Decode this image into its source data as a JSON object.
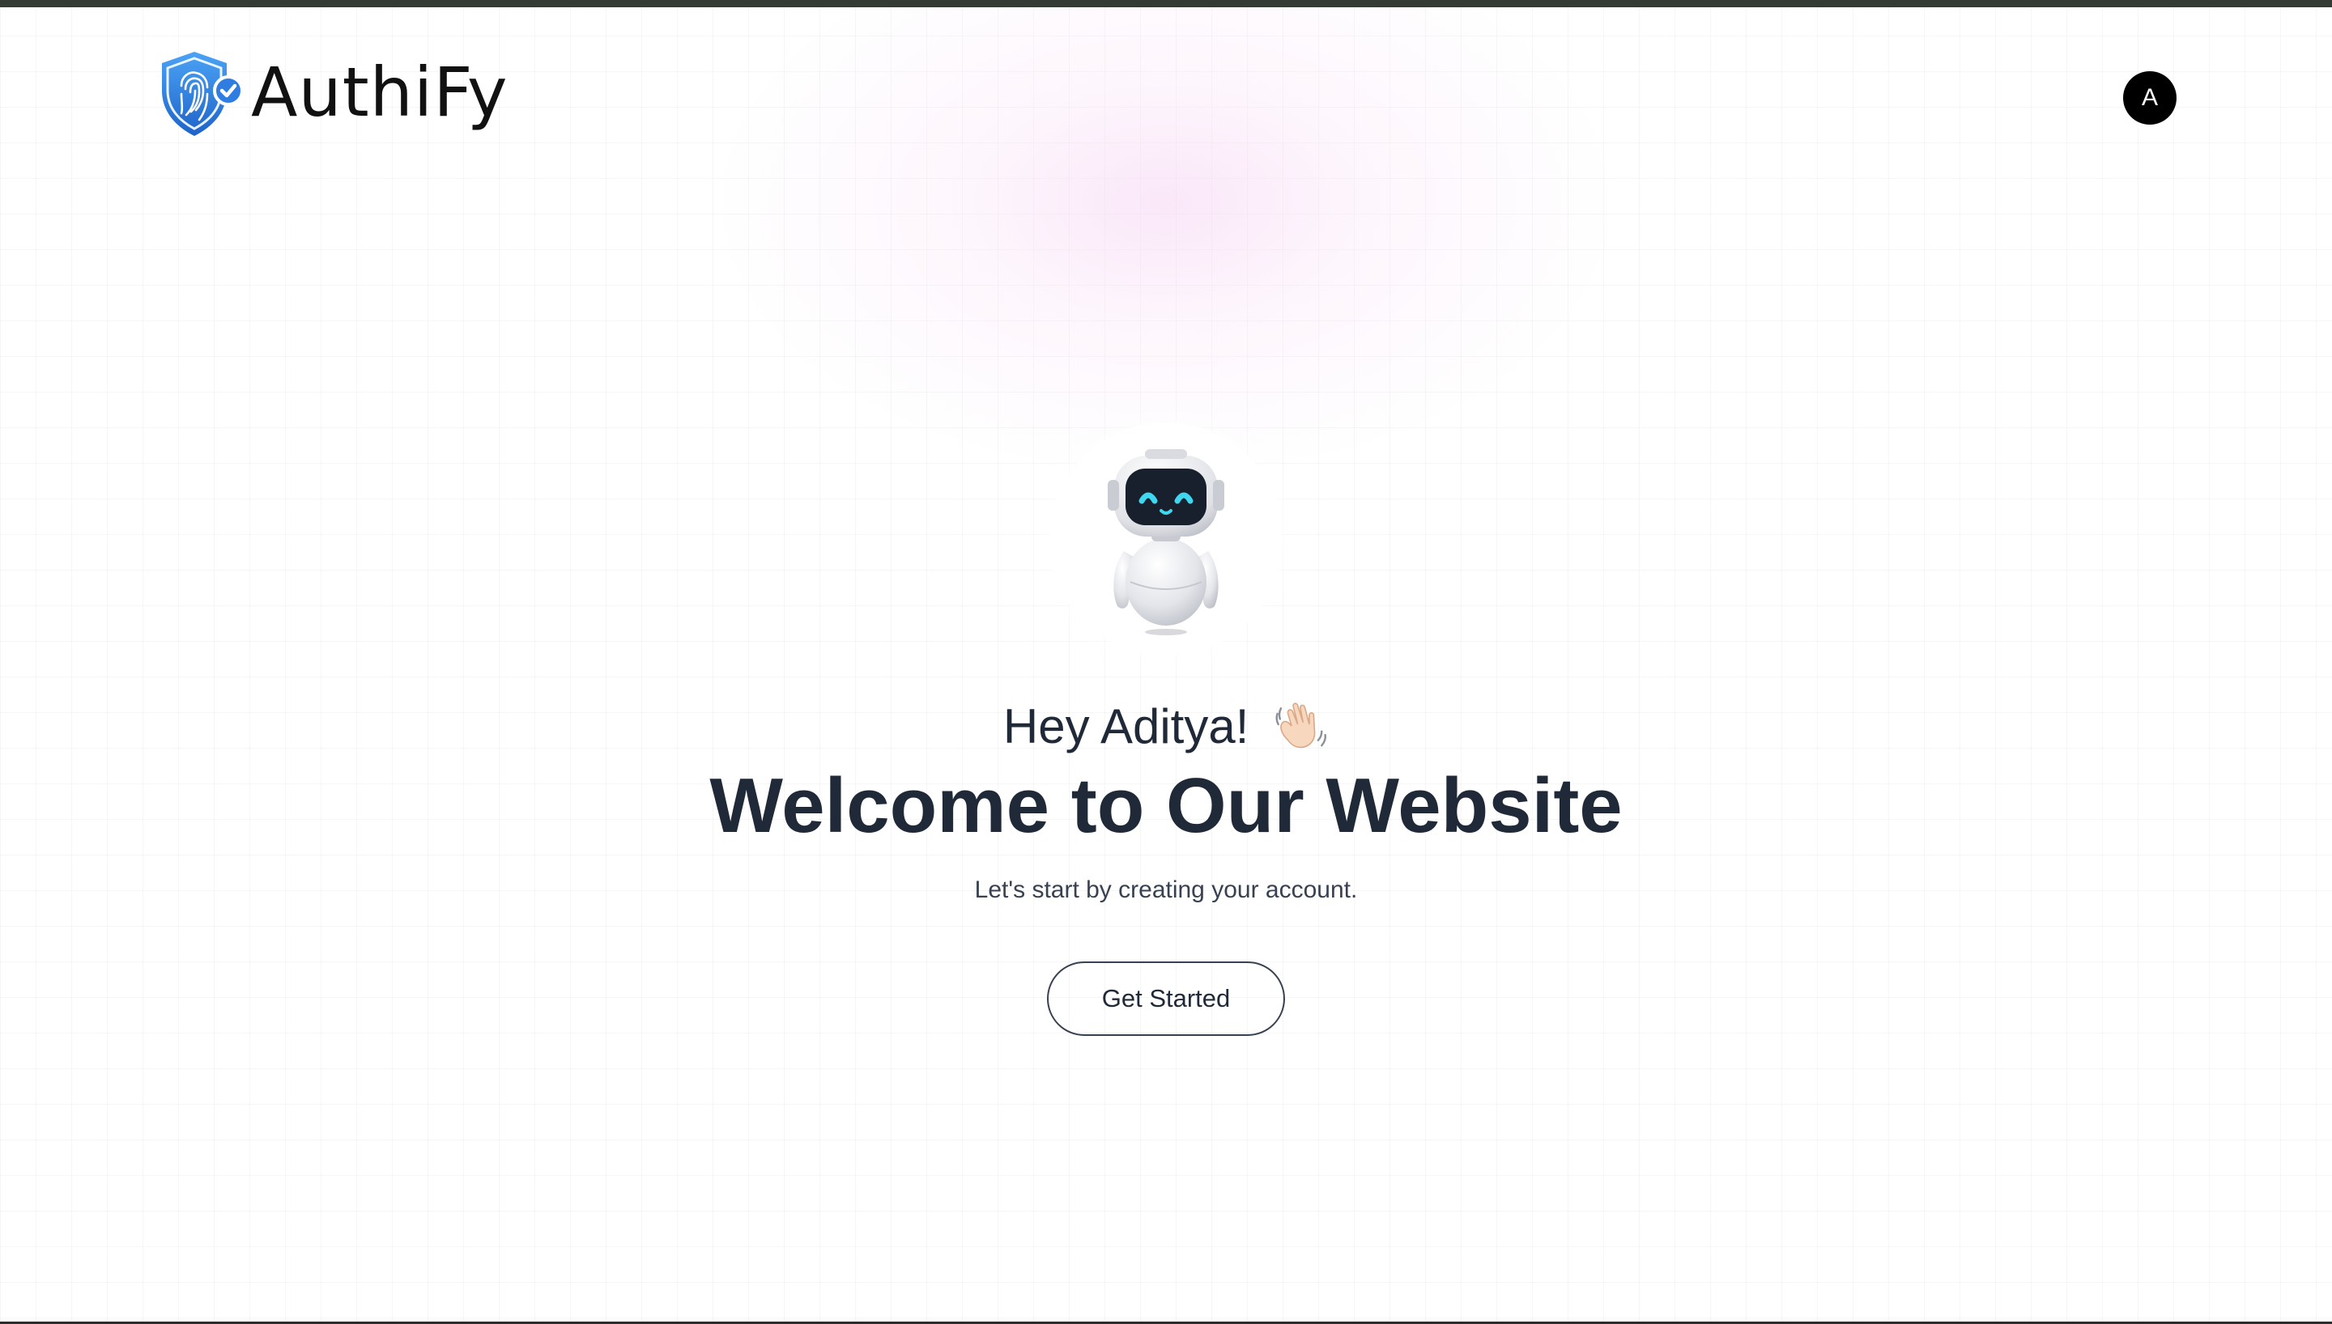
{
  "header": {
    "brand_name": "AuthiFy",
    "logo_icon": "fingerprint-shield-icon",
    "avatar_initial": "A"
  },
  "hero": {
    "illustration": "robot-icon",
    "greeting": "Hey Aditya!",
    "greeting_emoji": "waving-hand-icon",
    "headline": "Welcome to Our Website",
    "subtext": "Let's start by creating your account.",
    "cta_label": "Get Started"
  },
  "colors": {
    "brand_blue": "#2f7de1",
    "text_dark": "#1f2937",
    "topbar": "#343a34",
    "avatar_bg": "#000000",
    "glow_pink": "#f6d4f4",
    "robot_eye": "#3fd6f0"
  }
}
